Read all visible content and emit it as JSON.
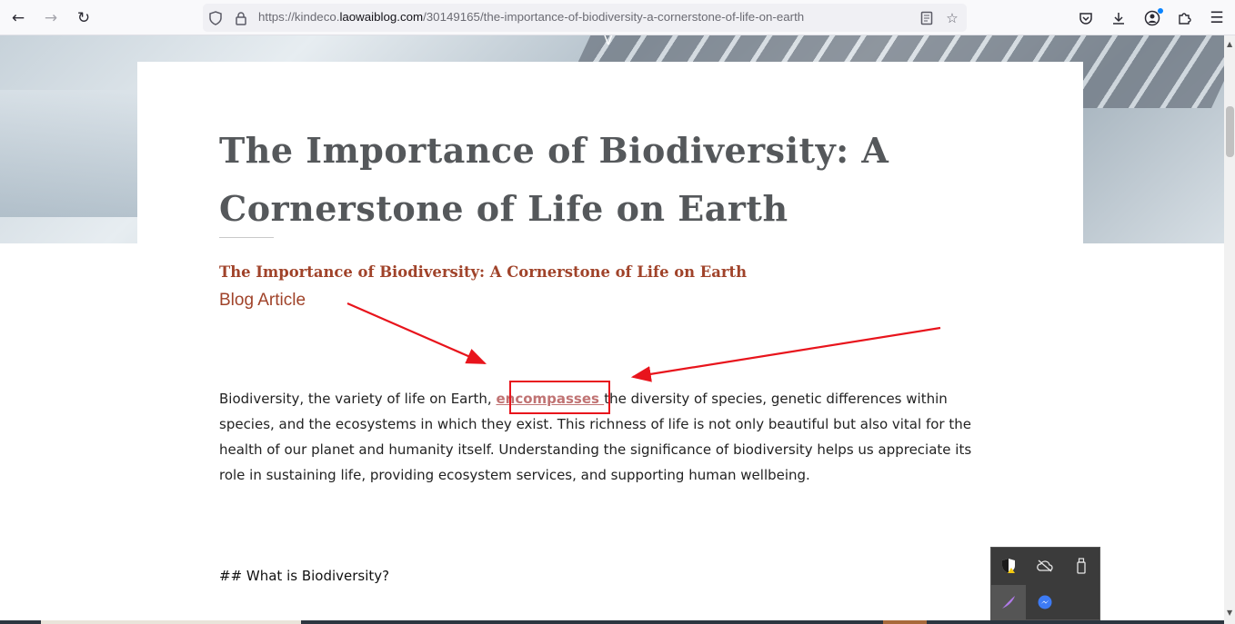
{
  "browser": {
    "url_prefix": "https://kindeco.",
    "url_host": "laowaiblog.com",
    "url_path": "/30149165/the-importance-of-biodiversity-a-cornerstone-of-life-on-earth"
  },
  "hero": {
    "chevron": "V"
  },
  "article": {
    "title": "The Importance of Biodiversity: A Cornerstone of Life on Earth",
    "subtitle": "The Importance of Biodiversity: A Cornerstone of Life on Earth",
    "category": "Blog Article",
    "body_before": "Biodiversity, the variety of life on Earth, ",
    "body_link": "encompasses ",
    "body_after": "the diversity of species, genetic differences within species, and the ecosystems in which they exist. This richness of life is not only beautiful but also vital for the health of our planet and humanity itself. Understanding the significance of biodiversity helps us appreciate its role in sustaining life, providing ecosystem services, and supporting human wellbeing.",
    "section_heading": "## What is Biodiversity?"
  },
  "colors": {
    "title": "#55585b",
    "accent": "#a0432a",
    "link": "#c07373",
    "annotation_red": "#e8141c"
  },
  "tray": {
    "icons": [
      "security-warning-icon",
      "cloud-offline-icon",
      "usb-drive-icon",
      "pen-feather-icon",
      "messenger-icon"
    ]
  }
}
